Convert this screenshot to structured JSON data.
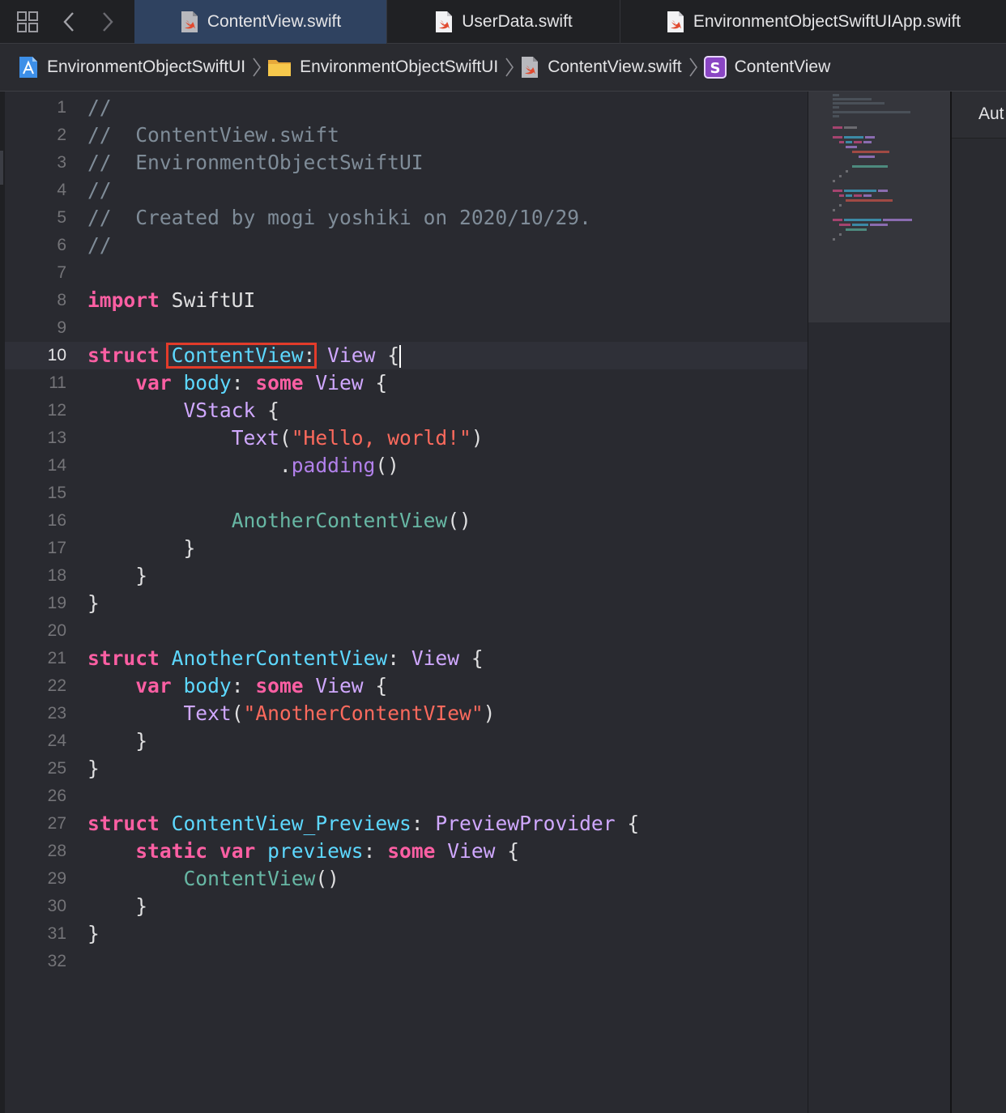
{
  "tabs": [
    {
      "label": "ContentView.swift",
      "active": true
    },
    {
      "label": "UserData.swift",
      "active": false
    },
    {
      "label": "EnvironmentObjectSwiftUIApp.swift",
      "active": false
    }
  ],
  "breadcrumb": [
    {
      "label": "EnvironmentObjectSwiftUI",
      "icon": "xcode-project-icon"
    },
    {
      "label": "EnvironmentObjectSwiftUI",
      "icon": "folder-icon"
    },
    {
      "label": "ContentView.swift",
      "icon": "swift-file-icon"
    },
    {
      "label": "ContentView",
      "icon": "struct-icon",
      "badge": "S"
    }
  ],
  "inspector": {
    "header": "Aut"
  },
  "editor": {
    "current_line": 10,
    "lines": [
      {
        "n": "1",
        "tokens": [
          {
            "t": "//",
            "c": "cm"
          }
        ]
      },
      {
        "n": "2",
        "tokens": [
          {
            "t": "//  ContentView.swift",
            "c": "cm"
          }
        ]
      },
      {
        "n": "3",
        "tokens": [
          {
            "t": "//  EnvironmentObjectSwiftUI",
            "c": "cm"
          }
        ]
      },
      {
        "n": "4",
        "tokens": [
          {
            "t": "//",
            "c": "cm"
          }
        ]
      },
      {
        "n": "5",
        "tokens": [
          {
            "t": "//  Created by mogi yoshiki on 2020/10/29.",
            "c": "cm"
          }
        ]
      },
      {
        "n": "6",
        "tokens": [
          {
            "t": "//",
            "c": "cm"
          }
        ]
      },
      {
        "n": "7",
        "tokens": []
      },
      {
        "n": "8",
        "tokens": [
          {
            "t": "import",
            "c": "kw"
          },
          {
            "t": " SwiftUI",
            "c": "pl"
          }
        ]
      },
      {
        "n": "9",
        "tokens": []
      },
      {
        "n": "10",
        "tokens": [
          {
            "t": "struct",
            "c": "kw"
          },
          {
            "t": " ",
            "c": "pl"
          },
          {
            "t": "ContentView",
            "c": "de"
          },
          {
            "t": ": ",
            "c": "pl"
          },
          {
            "t": "View",
            "c": "ty"
          },
          {
            "t": " {",
            "c": "pl"
          }
        ]
      },
      {
        "n": "11",
        "tokens": [
          {
            "t": "    ",
            "c": "pl"
          },
          {
            "t": "var",
            "c": "kw"
          },
          {
            "t": " ",
            "c": "pl"
          },
          {
            "t": "body",
            "c": "de"
          },
          {
            "t": ": ",
            "c": "pl"
          },
          {
            "t": "some",
            "c": "kw"
          },
          {
            "t": " ",
            "c": "pl"
          },
          {
            "t": "View",
            "c": "ty"
          },
          {
            "t": " {",
            "c": "pl"
          }
        ]
      },
      {
        "n": "12",
        "tokens": [
          {
            "t": "        ",
            "c": "pl"
          },
          {
            "t": "VStack",
            "c": "ty"
          },
          {
            "t": " {",
            "c": "pl"
          }
        ]
      },
      {
        "n": "13",
        "tokens": [
          {
            "t": "            ",
            "c": "pl"
          },
          {
            "t": "Text",
            "c": "ty"
          },
          {
            "t": "(",
            "c": "pl"
          },
          {
            "t": "\"Hello, world!\"",
            "c": "st"
          },
          {
            "t": ")",
            "c": "pl"
          }
        ]
      },
      {
        "n": "14",
        "tokens": [
          {
            "t": "                .",
            "c": "pl"
          },
          {
            "t": "padding",
            "c": "ot"
          },
          {
            "t": "()",
            "c": "pl"
          }
        ]
      },
      {
        "n": "15",
        "tokens": []
      },
      {
        "n": "16",
        "tokens": [
          {
            "t": "            ",
            "c": "pl"
          },
          {
            "t": "AnotherContentView",
            "c": "pr"
          },
          {
            "t": "()",
            "c": "pl"
          }
        ]
      },
      {
        "n": "17",
        "tokens": [
          {
            "t": "        }",
            "c": "pl"
          }
        ]
      },
      {
        "n": "18",
        "tokens": [
          {
            "t": "    }",
            "c": "pl"
          }
        ]
      },
      {
        "n": "19",
        "tokens": [
          {
            "t": "}",
            "c": "pl"
          }
        ]
      },
      {
        "n": "20",
        "tokens": []
      },
      {
        "n": "21",
        "tokens": [
          {
            "t": "struct",
            "c": "kw"
          },
          {
            "t": " ",
            "c": "pl"
          },
          {
            "t": "AnotherContentView",
            "c": "de"
          },
          {
            "t": ": ",
            "c": "pl"
          },
          {
            "t": "View",
            "c": "ty"
          },
          {
            "t": " {",
            "c": "pl"
          }
        ]
      },
      {
        "n": "22",
        "tokens": [
          {
            "t": "    ",
            "c": "pl"
          },
          {
            "t": "var",
            "c": "kw"
          },
          {
            "t": " ",
            "c": "pl"
          },
          {
            "t": "body",
            "c": "de"
          },
          {
            "t": ": ",
            "c": "pl"
          },
          {
            "t": "some",
            "c": "kw"
          },
          {
            "t": " ",
            "c": "pl"
          },
          {
            "t": "View",
            "c": "ty"
          },
          {
            "t": " {",
            "c": "pl"
          }
        ]
      },
      {
        "n": "23",
        "tokens": [
          {
            "t": "        ",
            "c": "pl"
          },
          {
            "t": "Text",
            "c": "ty"
          },
          {
            "t": "(",
            "c": "pl"
          },
          {
            "t": "\"AnotherContentVIew\"",
            "c": "st"
          },
          {
            "t": ")",
            "c": "pl"
          }
        ]
      },
      {
        "n": "24",
        "tokens": [
          {
            "t": "    }",
            "c": "pl"
          }
        ]
      },
      {
        "n": "25",
        "tokens": [
          {
            "t": "}",
            "c": "pl"
          }
        ]
      },
      {
        "n": "26",
        "tokens": []
      },
      {
        "n": "27",
        "tokens": [
          {
            "t": "struct",
            "c": "kw"
          },
          {
            "t": " ",
            "c": "pl"
          },
          {
            "t": "ContentView_Previews",
            "c": "de"
          },
          {
            "t": ": ",
            "c": "pl"
          },
          {
            "t": "PreviewProvider",
            "c": "ty"
          },
          {
            "t": " {",
            "c": "pl"
          }
        ]
      },
      {
        "n": "28",
        "tokens": [
          {
            "t": "    ",
            "c": "pl"
          },
          {
            "t": "static",
            "c": "kw"
          },
          {
            "t": " ",
            "c": "pl"
          },
          {
            "t": "var",
            "c": "kw"
          },
          {
            "t": " ",
            "c": "pl"
          },
          {
            "t": "previews",
            "c": "de"
          },
          {
            "t": ": ",
            "c": "pl"
          },
          {
            "t": "some",
            "c": "kw"
          },
          {
            "t": " ",
            "c": "pl"
          },
          {
            "t": "View",
            "c": "ty"
          },
          {
            "t": " {",
            "c": "pl"
          }
        ]
      },
      {
        "n": "29",
        "tokens": [
          {
            "t": "        ",
            "c": "pl"
          },
          {
            "t": "ContentView",
            "c": "pr"
          },
          {
            "t": "()",
            "c": "pl"
          }
        ]
      },
      {
        "n": "30",
        "tokens": [
          {
            "t": "    }",
            "c": "pl"
          }
        ]
      },
      {
        "n": "31",
        "tokens": [
          {
            "t": "}",
            "c": "pl"
          }
        ]
      },
      {
        "n": "32",
        "tokens": []
      }
    ]
  },
  "colors": {
    "background": "#292a30",
    "comment": "#7f8c98",
    "keyword": "#fc5fa3",
    "type": "#d0a8ff",
    "declaration": "#5dd8ff",
    "project_type": "#67b7a4",
    "string": "#fc6a5d",
    "method": "#b281eb",
    "highlight_box": "#e33b2a",
    "active_tab": "#2f4260"
  }
}
